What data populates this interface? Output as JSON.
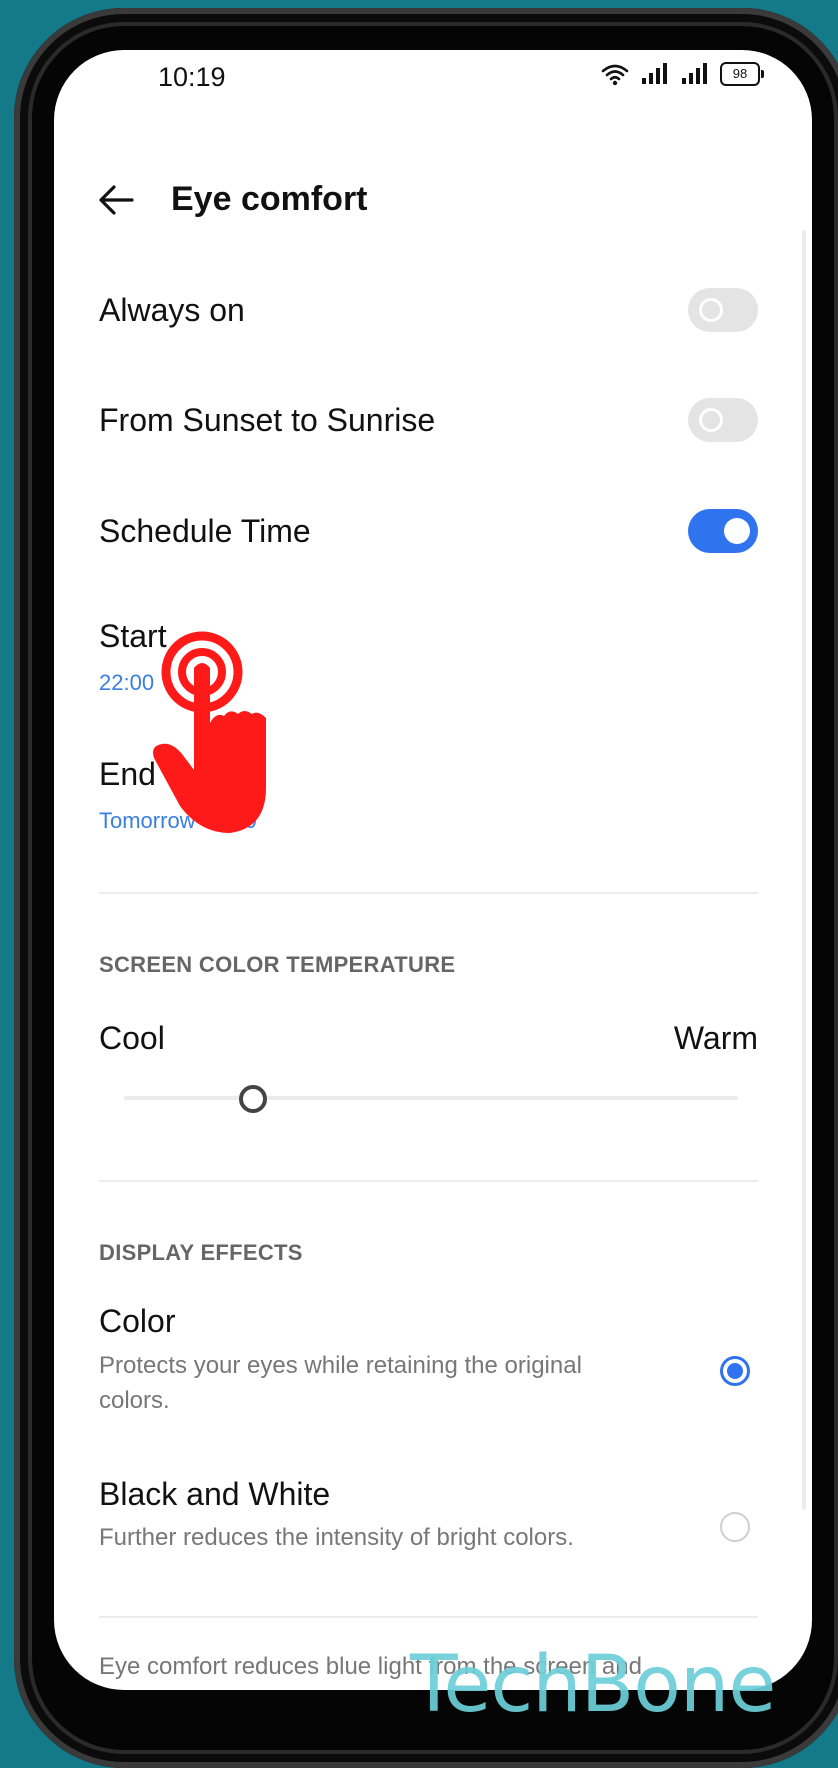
{
  "status_bar": {
    "time": "10:19",
    "battery": "98"
  },
  "header": {
    "title": "Eye comfort"
  },
  "settings": {
    "always_on": {
      "label": "Always on",
      "state": "off"
    },
    "sunset_sunrise": {
      "label": "From Sunset to Sunrise",
      "state": "off"
    },
    "schedule_time": {
      "label": "Schedule Time",
      "state": "on"
    },
    "start": {
      "label": "Start",
      "value": "22:00"
    },
    "end": {
      "label": "End",
      "value": "Tomorrow 07:00"
    }
  },
  "color_temperature": {
    "header": "SCREEN COLOR TEMPERATURE",
    "cool_label": "Cool",
    "warm_label": "Warm",
    "level": 0.21
  },
  "display_effects": {
    "header": "DISPLAY EFFECTS",
    "options": [
      {
        "title": "Color",
        "desc": "Protects your eyes while retaining the original colors.",
        "selected": true
      },
      {
        "title": "Black and White",
        "desc": "Further reduces the intensity of bright colors.",
        "selected": false
      }
    ]
  },
  "footer_note": "Eye comfort reduces blue light from the screen and prevents eye strain.",
  "watermark": "TechBone",
  "colors": {
    "accent": "#2f73ee",
    "tap_indicator": "#ff1a1a",
    "background": "#147a8a"
  },
  "icons": [
    "back-arrow-icon",
    "wifi-icon",
    "signal-icon",
    "battery-icon",
    "tap-hand-icon"
  ]
}
